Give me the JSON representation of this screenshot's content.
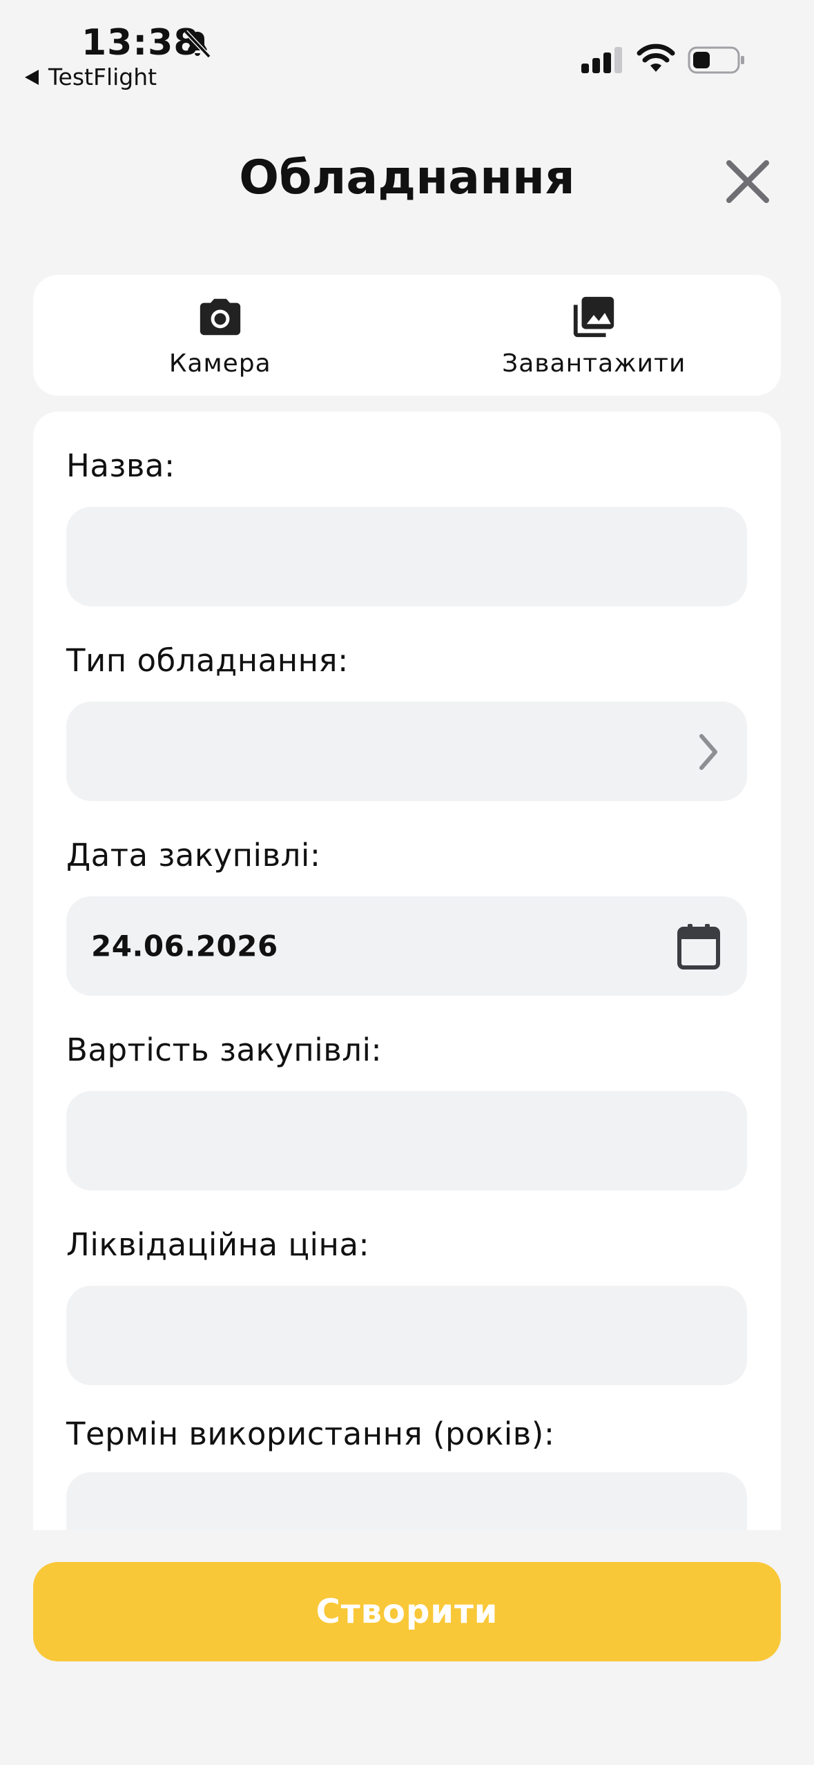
{
  "status_bar": {
    "time": "13:38",
    "back_label": "TestFlight"
  },
  "header": {
    "title": "Обладнання"
  },
  "media": {
    "camera_label": "Камера",
    "upload_label": "Завантажити"
  },
  "form": {
    "name_label": "Назва:",
    "name_value": "",
    "type_label": "Тип обладнання:",
    "type_value": "",
    "date_label": "Дата закупівлі:",
    "date_value": "24.06.2026",
    "cost_label": "Вартість закупівлі:",
    "cost_value": "",
    "liquidation_label": "Ліквідаційна ціна:",
    "liquidation_value": "",
    "term_label": "Термін використання (років):",
    "term_value": ""
  },
  "actions": {
    "create_label": "Створити"
  },
  "colors": {
    "background": "#F4F4F5",
    "card": "#FFFFFF",
    "input_fill": "#F1F2F4",
    "accent_yellow": "#F9C838",
    "icon_gray": "#8E8E93"
  },
  "icons": [
    "bell-slash-icon",
    "signal-icon",
    "wifi-icon",
    "battery-icon",
    "close-icon",
    "camera-icon",
    "gallery-icon",
    "chevron-right-icon",
    "calendar-icon"
  ]
}
